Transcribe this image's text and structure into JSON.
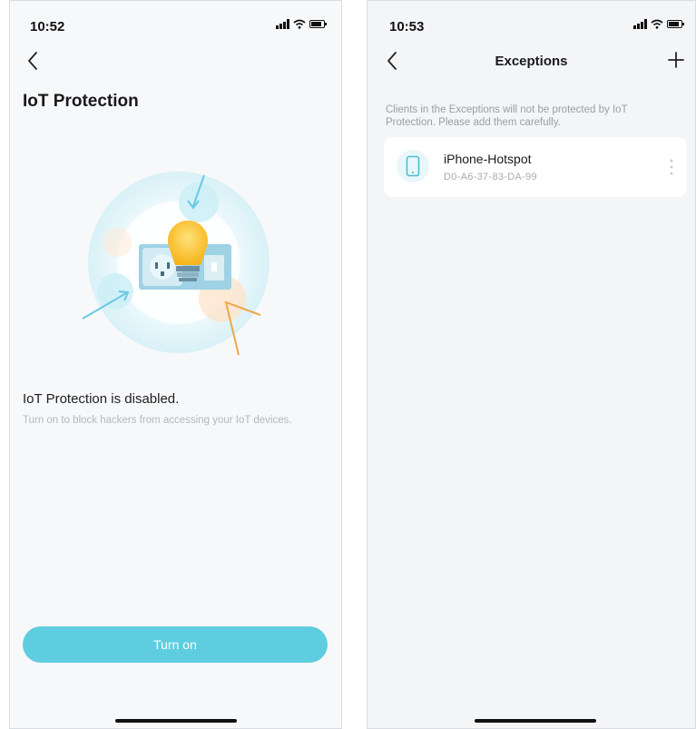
{
  "left_screen": {
    "status_bar": {
      "time": "10:52"
    },
    "page_title": "IoT Protection",
    "status_heading": "IoT Protection is disabled.",
    "status_description": "Turn on to block hackers from accessing your IoT devices.",
    "turn_on_button": "Turn on"
  },
  "right_screen": {
    "status_bar": {
      "time": "10:53"
    },
    "nav_title": "Exceptions",
    "info_text": "Clients in the Exceptions will not be protected by IoT Protection. Please add them carefully.",
    "clients": [
      {
        "name": "iPhone-Hotspot",
        "mac": "D0-A6-37-83-DA-99",
        "icon": "phone-icon"
      }
    ]
  },
  "colors": {
    "accent": "#5fcde0",
    "background": "#f7f8fa",
    "muted_text": "#b3b7bc"
  },
  "icons": [
    "back-arrow-icon",
    "plus-icon",
    "phone-icon",
    "more-vertical-icon",
    "signal-icon",
    "wifi-icon",
    "battery-icon",
    "lightbulb-icon",
    "power-outlet-icon"
  ]
}
